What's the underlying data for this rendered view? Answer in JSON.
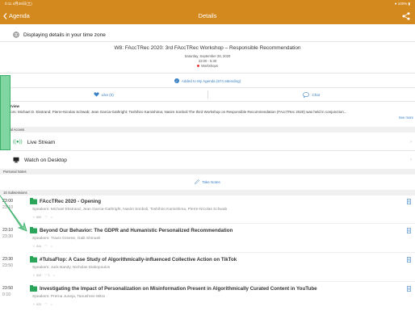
{
  "status": {
    "time": "0:11",
    "date": "4月26日(土)",
    "battery": "100%"
  },
  "nav": {
    "back_label": "Agenda",
    "title": "Details"
  },
  "timezone_text": "Displaying details in your time zone",
  "event": {
    "title": "W8: FAccTRec 2020: 3rd FAccTRec Workshop – Responsible Recommendation",
    "date": "Saturday, September 26, 2020",
    "time": "23:00 - 5:30",
    "tag": "Workshops"
  },
  "agenda_status": "Added to My Agenda (874 attending)",
  "like_label": "Like (0)",
  "chat_label": "Chat",
  "overview": {
    "label": "Overview",
    "text": "Authors: Michael D. Ekstrand; Pierre-Nicolas Schwab; Jean Garcia-Gathright; Toshihiro Kamishima; Nasim Sonboli The third Workshop on Responsible Recommendation (FAccTRec 2020) was held in conjunction...",
    "see_more": "See more"
  },
  "virtual_access_header": "Virtual Access",
  "live_stream_label": "Live Stream",
  "watch_desktop_label": "Watch on Desktop",
  "personal_notes_header": "Personal Notes",
  "take_notes_label": "Take Notes",
  "subsessions_header": "16 Subsessions",
  "subsessions": [
    {
      "start": "23:00",
      "end": "23:10",
      "title": "FAccTRec 2020 - Opening",
      "speakers": "Speakers: Michael Ekstrand, Jean Garcia-Gathright, Nasim Sonboli, Toshihiro Kamishima, Pierre-Nicolas Schwab",
      "attending": "886",
      "likes": ""
    },
    {
      "start": "23:10",
      "end": "23:30",
      "title": "Beyond Our Behavior: The GDPR and Humanistic Personalized Recommendation",
      "speakers": "Speakers: Travis Greene, Galit Shmueli",
      "attending": "844",
      "likes": ""
    },
    {
      "start": "23:30",
      "end": "23:50",
      "title": "#TulsaFlop: A Case Study of Algorithmically-influenced Collective Action on TikTok",
      "speakers": "Speakers: Jack Bandy, Nicholas Diakopoulos",
      "attending": "834",
      "likes": "1"
    },
    {
      "start": "23:50",
      "end": "0:10",
      "title": "Investigating the Impact of Personalization on Misinformation Present in Algorithmically Curated Content in YouTube",
      "speakers": "Speakers: Prerna Juneja, Tanushree Mitra",
      "attending": "825",
      "likes": ""
    }
  ],
  "colors": {
    "accent": "#d4891f",
    "link": "#3b82c4",
    "green": "#2aa55a",
    "callout": "#7fd6a0"
  }
}
